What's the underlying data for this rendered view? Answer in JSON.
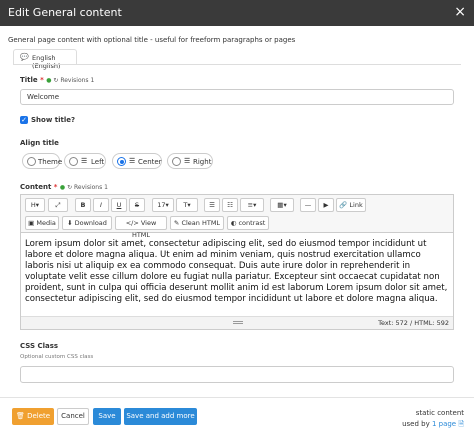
{
  "window": {
    "title": "Edit General content",
    "close": "×"
  },
  "description": "General page content with optional title - useful for freeform paragraphs or pages",
  "lang_tab": "English (English)",
  "title_field": {
    "label": "Title",
    "required": "*",
    "revisions": "Revisions 1",
    "value": "Welcome"
  },
  "show_title": {
    "label": "Show title?",
    "checked": true
  },
  "align": {
    "label": "Align title",
    "options": [
      {
        "label": "Theme",
        "selected": false
      },
      {
        "label": "Left",
        "selected": false
      },
      {
        "label": "Center",
        "selected": true
      },
      {
        "label": "Right",
        "selected": false
      }
    ]
  },
  "content_field": {
    "label": "Content",
    "required": "*",
    "revisions": "Revisions 1"
  },
  "toolbar": {
    "row1": [
      "H▾",
      "⤢",
      "B",
      "I",
      "U",
      "S",
      "17▾",
      "T▾",
      "☰",
      "☷",
      "≡▾",
      "▦▾",
      "—",
      "▶",
      "Link"
    ],
    "row2": [
      "Media",
      "Download",
      "View HTML",
      "Clean HTML",
      "contrast"
    ]
  },
  "content_text": "Lorem ipsum dolor sit amet, consectetur adipiscing elit, sed do eiusmod tempor incididunt ut labore et dolore magna aliqua. Ut enim ad minim veniam, quis nostrud exercitation ullamco laboris nisi ut aliquip ex ea commodo consequat. Duis aute irure dolor in reprehenderit in voluptate velit esse cillum dolore eu fugiat nulla pariatur. Excepteur sint occaecat cupidatat non proident, sunt in culpa qui officia deserunt mollit anim id est laborum Lorem ipsum dolor sit amet, consectetur adipiscing elit, sed do eiusmod tempor incididunt ut labore et dolore magna aliqua.",
  "text_count": "Text: 572 / HTML: 592",
  "css_class": {
    "label": "CSS Class",
    "hint": "Optional custom CSS class",
    "value": ""
  },
  "footer": {
    "delete": "Delete",
    "cancel": "Cancel",
    "save": "Save",
    "save_add": "Save and add more",
    "static_line1": "static content",
    "used_by": "used by",
    "used_link": "1 page"
  },
  "colors": {
    "accent": "#2b8ad8",
    "delete": "#f0a030",
    "titlebar": "#3a3a3a"
  },
  "icons": {
    "close": "close-icon",
    "bubble": "chat-bubble-icon",
    "history": "history-icon",
    "trash": "trash-icon",
    "doc": "document-icon"
  }
}
